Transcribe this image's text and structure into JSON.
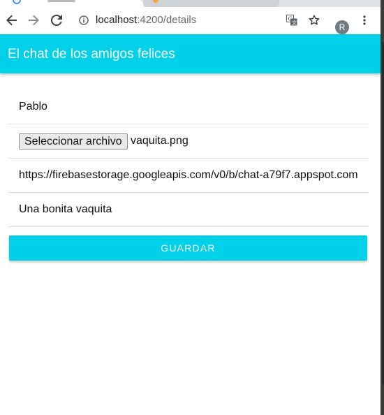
{
  "browser": {
    "url_host": "localhost",
    "url_path": ":4200/details",
    "profile_initial": "R"
  },
  "app": {
    "title": "El chat de los amigos felices",
    "accent_color": "#00d0e8"
  },
  "form": {
    "name_value": "Pablo",
    "file_button_label": "Seleccionar archivo",
    "file_name": "vaquita.png",
    "image_url_value": "https://firebasestorage.googleapis.com/v0/b/chat-a79f7.appspot.com",
    "description_value": "Una bonita vaquita",
    "save_label": "GUARDAR"
  },
  "icons": [
    "back-arrow-icon",
    "forward-arrow-icon",
    "reload-icon",
    "info-icon",
    "translate-icon",
    "star-icon",
    "more-vert-icon"
  ]
}
